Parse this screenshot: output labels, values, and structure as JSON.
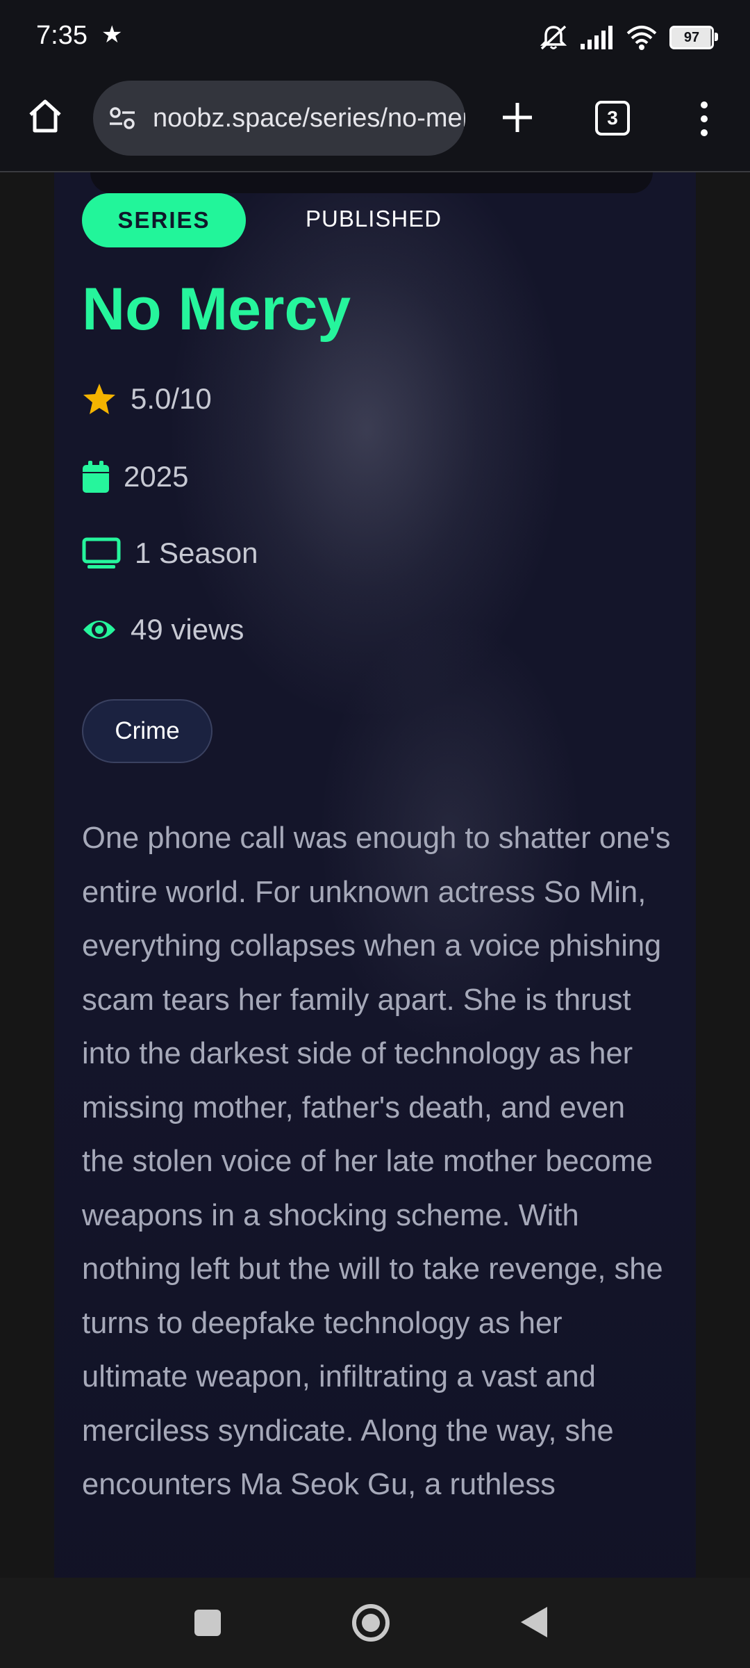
{
  "status_bar": {
    "time": "7:35",
    "battery": "97",
    "icons": [
      "star-icon",
      "mute-icon",
      "signal-icon",
      "wifi-icon",
      "battery-icon"
    ]
  },
  "browser": {
    "url": "noobz.space/series/no-mercy",
    "tab_count": "3",
    "icons": [
      "home-icon",
      "site-settings-icon",
      "plus-icon",
      "tabs-icon",
      "more-vert-icon"
    ]
  },
  "series": {
    "type_badge": "SERIES",
    "status_badge": "PUBLISHED",
    "title": "No Mercy",
    "rating": "5.0/10",
    "year": "2025",
    "seasons": "1 Season",
    "views": "49 views",
    "genres": [
      "Crime"
    ],
    "synopsis": "One phone call was enough to shatter one's entire world. For unknown actress So Min, everything collapses when a voice phishing scam tears her family apart. She is thrust into the darkest side of technology as her missing mother, father's death, and even the stolen voice of her late mother become weapons in a shocking scheme. With nothing left but the will to take revenge, she turns to deepfake technology as her ultimate weapon, infiltrating a vast and merciless syndicate. Along the way, she encounters Ma Seok Gu, a ruthless"
  },
  "colors": {
    "accent": "#26f59c",
    "star": "#f5b400",
    "card_bg": "#14152a",
    "text_muted": "#a6a9b9"
  },
  "nav_bar": {
    "icons": [
      "recents-icon",
      "home-circle-icon",
      "back-icon"
    ]
  }
}
